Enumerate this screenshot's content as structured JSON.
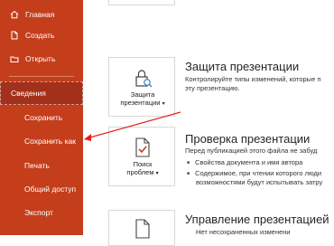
{
  "sidebar": {
    "items": [
      {
        "label": "Главная",
        "icon": "home-icon"
      },
      {
        "label": "Создать",
        "icon": "new-document-icon"
      },
      {
        "label": "Открыть",
        "icon": "open-folder-icon"
      },
      {
        "label": "Сведения",
        "selected": true
      },
      {
        "label": "Сохранить"
      },
      {
        "label": "Сохранить как"
      },
      {
        "label": "Печать"
      },
      {
        "label": "Общий доступ"
      },
      {
        "label": "Экспорт"
      }
    ],
    "bg_color": "#c43e1c",
    "selected_color": "#a3301a"
  },
  "protect": {
    "button_label_1": "Защита",
    "button_label_2": "презентации",
    "button_arrow": "▾",
    "title": "Защита презентации",
    "desc_1": "Контролируйте типы изменений, которые п",
    "desc_2": "эту презентацию."
  },
  "inspect": {
    "button_label_1": "Поиск",
    "button_label_2": "проблем",
    "button_arrow": "▾",
    "title": "Проверка презентации",
    "desc_1": "Перед публикацией этого файла не забуд",
    "bullet_1": "Свойства документа и имя автора",
    "bullet_2": "Содержимое, при чтении которого люди",
    "bullet_2_cont": "возможностями будут испытывать затру"
  },
  "manage": {
    "title": "Управление презентацией",
    "desc_1": "Нет несохраненных изменени"
  },
  "annotation": {
    "arrow_color": "#e0201e"
  }
}
